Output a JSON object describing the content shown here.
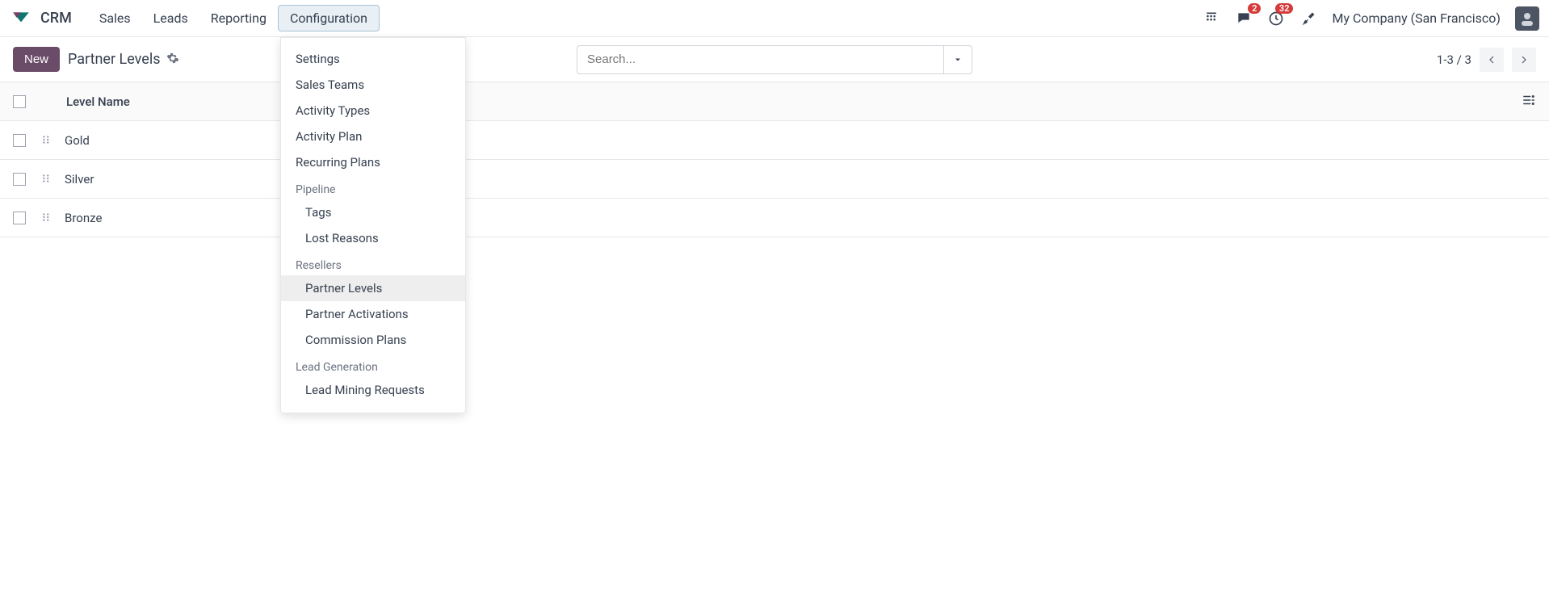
{
  "app": {
    "name": "CRM"
  },
  "nav": {
    "sales": "Sales",
    "leads": "Leads",
    "reporting": "Reporting",
    "configuration": "Configuration"
  },
  "topbar": {
    "messages_badge": "2",
    "activities_badge": "32",
    "company": "My Company (San Francisco)"
  },
  "toolbar": {
    "new_label": "New",
    "breadcrumb": "Partner Levels",
    "search_placeholder": "Search...",
    "pager": "1-3 / 3"
  },
  "table": {
    "header": "Level Name",
    "rows": [
      {
        "name": "Gold"
      },
      {
        "name": "Silver"
      },
      {
        "name": "Bronze"
      }
    ]
  },
  "config_menu": {
    "settings": "Settings",
    "sales_teams": "Sales Teams",
    "activity_types": "Activity Types",
    "activity_plan": "Activity Plan",
    "recurring_plans": "Recurring Plans",
    "pipeline_header": "Pipeline",
    "tags": "Tags",
    "lost_reasons": "Lost Reasons",
    "resellers_header": "Resellers",
    "partner_levels": "Partner Levels",
    "partner_activations": "Partner Activations",
    "commission_plans": "Commission Plans",
    "leadgen_header": "Lead Generation",
    "lead_mining": "Lead Mining Requests"
  }
}
